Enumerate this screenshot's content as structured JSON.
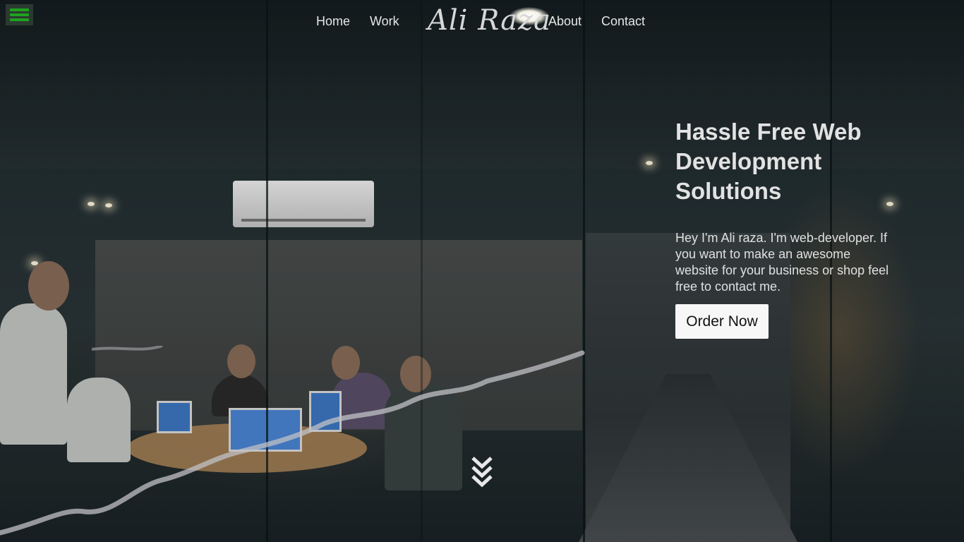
{
  "nav": {
    "brand": "Ali Raza",
    "links": [
      {
        "label": "Home"
      },
      {
        "label": "Work"
      },
      {
        "label": "About"
      },
      {
        "label": "Contact"
      }
    ]
  },
  "hero": {
    "heading_lines": [
      "Hassle Free Web",
      "Development",
      "Solutions"
    ],
    "description": "Hey I'm Ali raza. I'm web-developer. If you want to make an awesome website for your business or shop feel free to contact me.",
    "cta_label": "Order Now"
  },
  "icons": {
    "menu": "hamburger-menu-icon",
    "scroll": "chevron-double-down-icon"
  },
  "colors": {
    "menu_icon": "#1fa21f",
    "nav_text": "#e6e6e6",
    "cta_background": "#f7f7f7"
  }
}
